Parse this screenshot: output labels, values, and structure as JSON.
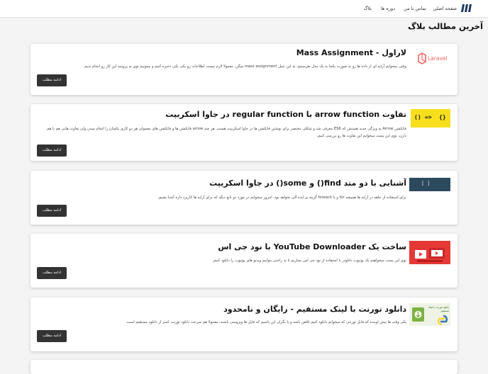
{
  "navbar": {
    "links": [
      {
        "label": "صفحه اصلی"
      },
      {
        "label": "تماس با من"
      },
      {
        "label": "دوره ها"
      },
      {
        "label": "بلاگ"
      }
    ]
  },
  "page": {
    "title": "آخرین مطالب بلاگ"
  },
  "posts": [
    {
      "title": "لاراول - Mass Assignment",
      "excerpt": "وقتی میخوایم آرایه ای از داده ها رو به صورت یکجا به یک مدل بفرستیم، به این عمل mass assignment میگن. معمولا لازم نیست اطلاعات رو یکی یکی ذخیره کنیم و میتونیم توی یه پروسه این کار رو انجام بدیم.",
      "button": "ادامه مطلب",
      "thumb_text": "Laravel",
      "thumb_color": "#f4645f"
    },
    {
      "title": "تفاوت arrow function با regular function در جاوا اسکریپت",
      "excerpt": "فانکشن Arrow یه ویژگی جدید هستش که ES6 معرفی شد و شکلی مختصر برای نوشتن فانکشن ها در جاوا اسکریپت هست. هر چند arrow فانکشن ها و فانکشن های معمولی هر دو کاری یکسان را انجام میدن ولی تفاوت هایی هم با هم دارن، توی این پست میخوایم این تفاوت ها رو بررسی کنیم.",
      "button": "ادامه مطلب",
      "thumb_left": "()",
      "thumb_arrow": "=>",
      "thumb_right": "{}",
      "thumb_color": "#f7df1e"
    },
    {
      "title": "آشنایی با دو متد find() و some() در جاوا اسکریپت",
      "excerpt": "برای استفاده از حلقه در آرایه ها همیشه for و یا foreach گزینه ی ایده آلی نخواهد بود، امروز میخوایم در مورد دو تابع دیگه که برای آرایه ها کاربرد داره آشنا بشیم.",
      "button": "ادامه مطلب",
      "thumb_text": "[ ]",
      "thumb_color": "#2c4a5e"
    },
    {
      "title": "ساخت یک YouTube Downloader با نود جی اس",
      "excerpt": "توی این پست میخواهیم یک یوتیوب دانلودر با استفاده از نود جی اس بسازیم تا به راحتی بتوانیم ویدیو های یوتیوب را دانلود کنیم.",
      "button": "ادامه مطلب",
      "thumb_color": "#e53935"
    },
    {
      "title": "دانلود تورنت با لینک مستقیم - رایگان و نامحدود",
      "excerpt": "یکی وقت ها پیش اومده که فایل تورنتی که میخوایم دانلود کنیم ناقص باشه و یا نگران این باشیم که فایل ها ویروسی باشند، معمولا هم سرعت دانلود تورنت کمتر از دانلود مستقیم است.",
      "button": "ادامه مطلب",
      "thumb_text": "دانلود تورنت با لینک مستقیم",
      "thumb_color": "#7cb342"
    }
  ]
}
